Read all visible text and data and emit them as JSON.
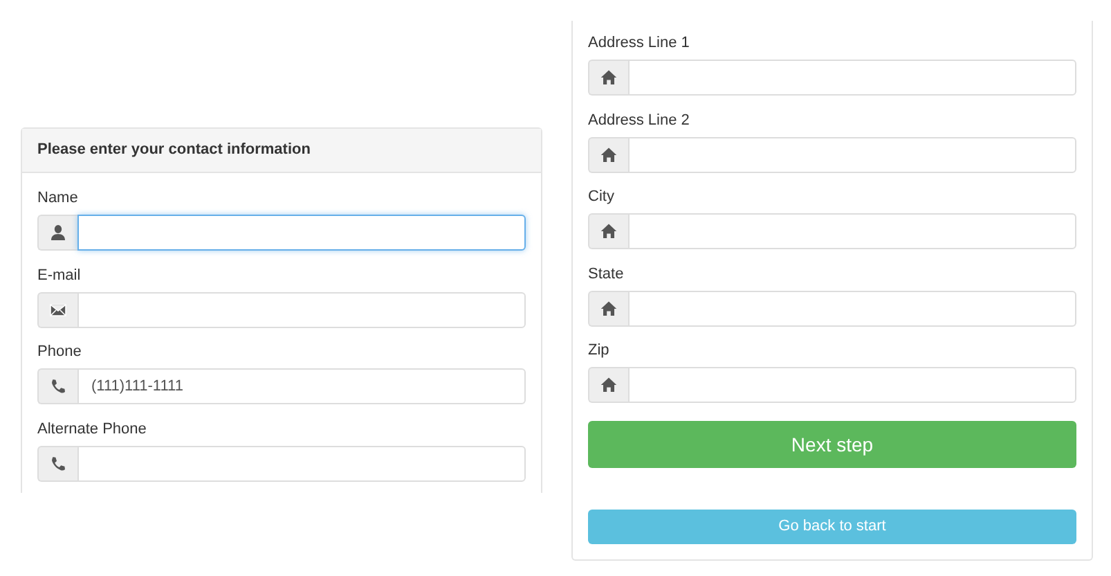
{
  "contact_panel": {
    "title": "Please enter your contact information",
    "fields": [
      {
        "label": "Name",
        "kind": "person",
        "focused": true
      },
      {
        "label": "E-mail",
        "kind": "email",
        "focused": false
      },
      {
        "label": "Phone",
        "kind": "phone",
        "value": "(111)111-1111",
        "focused": false
      },
      {
        "label": "Alternate Phone",
        "kind": "phone",
        "focused": false
      }
    ]
  },
  "address_panel": {
    "fields": [
      {
        "label": "Address Line 1",
        "kind": "address",
        "focused": false
      },
      {
        "label": "Address Line 2",
        "kind": "address",
        "focused": false
      },
      {
        "label": "City",
        "kind": "address",
        "focused": false
      },
      {
        "label": "State",
        "kind": "address",
        "focused": false
      },
      {
        "label": "Zip",
        "kind": "address",
        "focused": false
      }
    ],
    "buttons": [
      {
        "label": "Next step",
        "kind": "primary"
      },
      {
        "label": "Go back to start",
        "kind": "secondary"
      }
    ]
  }
}
